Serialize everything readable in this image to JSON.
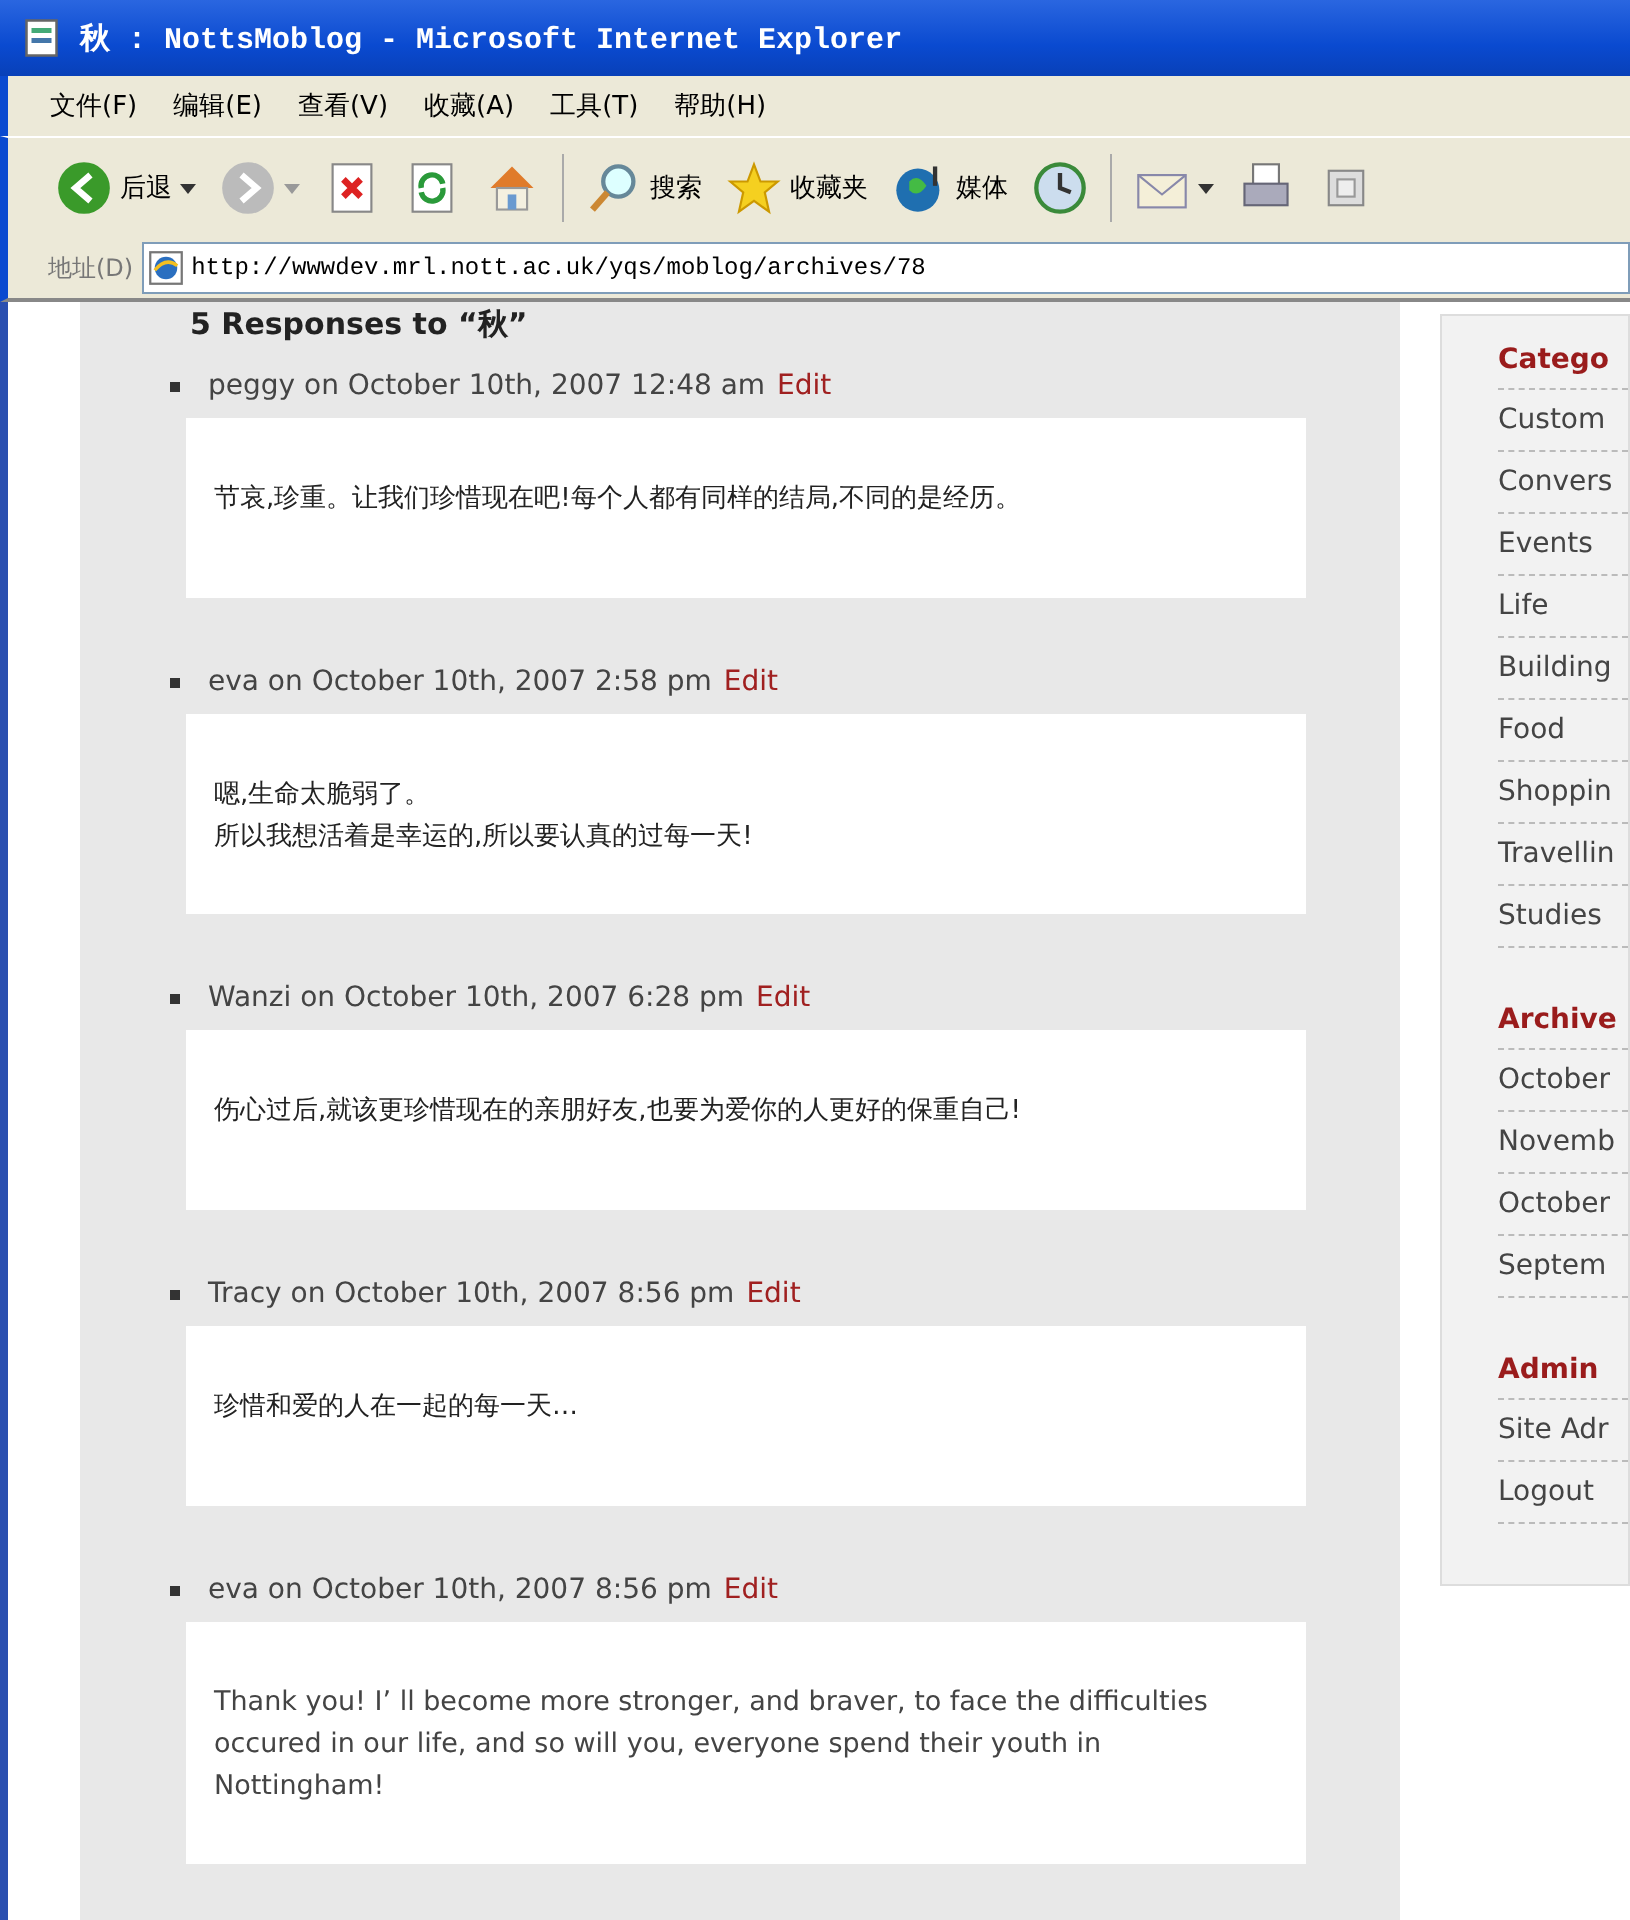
{
  "window": {
    "title": "秋 : NottsMoblog - Microsoft Internet Explorer"
  },
  "menu": [
    "文件(F)",
    "编辑(E)",
    "查看(V)",
    "收藏(A)",
    "工具(T)",
    "帮助(H)"
  ],
  "toolbar": [
    {
      "kind": "back",
      "label": "后退"
    },
    {
      "kind": "forward"
    },
    {
      "kind": "stop"
    },
    {
      "kind": "refresh"
    },
    {
      "kind": "home"
    },
    {
      "kind": "search",
      "label": "搜索"
    },
    {
      "kind": "favorites",
      "label": "收藏夹"
    },
    {
      "kind": "media",
      "label": "媒体"
    },
    {
      "kind": "history"
    },
    {
      "kind": "mail"
    },
    {
      "kind": "print"
    },
    {
      "kind": "edit"
    }
  ],
  "address": {
    "label": "地址(D)",
    "value": "http://wwwdev.mrl.nott.ac.uk/yqs/moblog/archives/78"
  },
  "comments_heading": "5 Responses to “秋”",
  "comments": [
    {
      "author": "peggy",
      "date": "on October 10th, 2007 12:48 am",
      "edit": "Edit",
      "body": [
        "节哀,珍重。让我们珍惜现在吧!每个人都有同样的结局,不同的是经历。"
      ]
    },
    {
      "author": "eva",
      "date": "on October 10th, 2007 2:58 pm",
      "edit": "Edit",
      "body": [
        "嗯,生命太脆弱了。",
        "所以我想活着是幸运的,所以要认真的过每一天!"
      ]
    },
    {
      "author": "Wanzi",
      "date": "on October 10th, 2007 6:28 pm",
      "edit": "Edit",
      "body": [
        "伤心过后,就该更珍惜现在的亲朋好友,也要为爱你的人更好的保重自己!"
      ]
    },
    {
      "author": "Tracy",
      "date": "on October 10th, 2007 8:56 pm",
      "edit": "Edit",
      "body": [
        "珍惜和爱的人在一起的每一天…"
      ]
    },
    {
      "author": "eva",
      "date": "on October 10th, 2007 8:56 pm",
      "edit": "Edit",
      "body": [
        "Thank you! I’ ll become more stronger, and braver, to face the difficulties occured in our life, and so will you, everyone spend their youth in Nottingham!"
      ]
    }
  ],
  "sidebar": [
    {
      "heading": "Catego",
      "items": [
        "Custom",
        "Convers",
        "Events",
        "Life",
        "Building",
        "Food",
        "Shoppin",
        "Travellin",
        "Studies"
      ]
    },
    {
      "heading": "Archive",
      "items": [
        "October",
        "Novemb",
        "October",
        "Septem"
      ]
    },
    {
      "heading": "Admin",
      "items": [
        "Site Adr",
        "Logout"
      ]
    }
  ]
}
